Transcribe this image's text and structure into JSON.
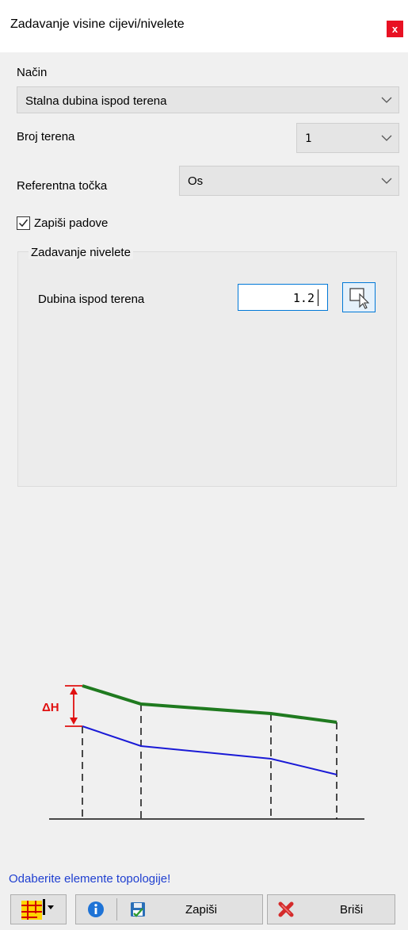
{
  "window": {
    "title": "Zadavanje visine cijevi/nivelete",
    "close_label": "x"
  },
  "nacin": {
    "label": "Način",
    "value": "Stalna dubina ispod terena"
  },
  "broj_terena": {
    "label": "Broj terena",
    "value": "1"
  },
  "referentna_tocka": {
    "label": "Referentna točka",
    "value": "Os"
  },
  "zapisi_padove": {
    "label": "Zapiši padove",
    "checked": true
  },
  "nivelete_group": {
    "title": "Zadavanje nivelete",
    "dubina_label": "Dubina ispod terena",
    "dubina_value": "1.2"
  },
  "diagram": {
    "delta_label": "ΔH"
  },
  "status_text": "Odaberite elemente topologije!",
  "buttons": {
    "save_label": "Zapiši",
    "delete_label": "Briši"
  },
  "icons": {
    "close": "close-icon",
    "dropdown": "chevron-down-icon",
    "checkbox": "checkmark-icon",
    "pick": "select-cursor-icon",
    "topology": "topology-grid-icon",
    "info": "info-icon",
    "save": "save-icon",
    "delete": "delete-x-icon"
  },
  "colors": {
    "close_bg": "#e81123",
    "terrain_line": "#1f7a1f",
    "pipe_line": "#1a1ad6",
    "delta_marker": "#e01010",
    "status_text": "#1f3fd0",
    "focus_border": "#0078d7"
  }
}
